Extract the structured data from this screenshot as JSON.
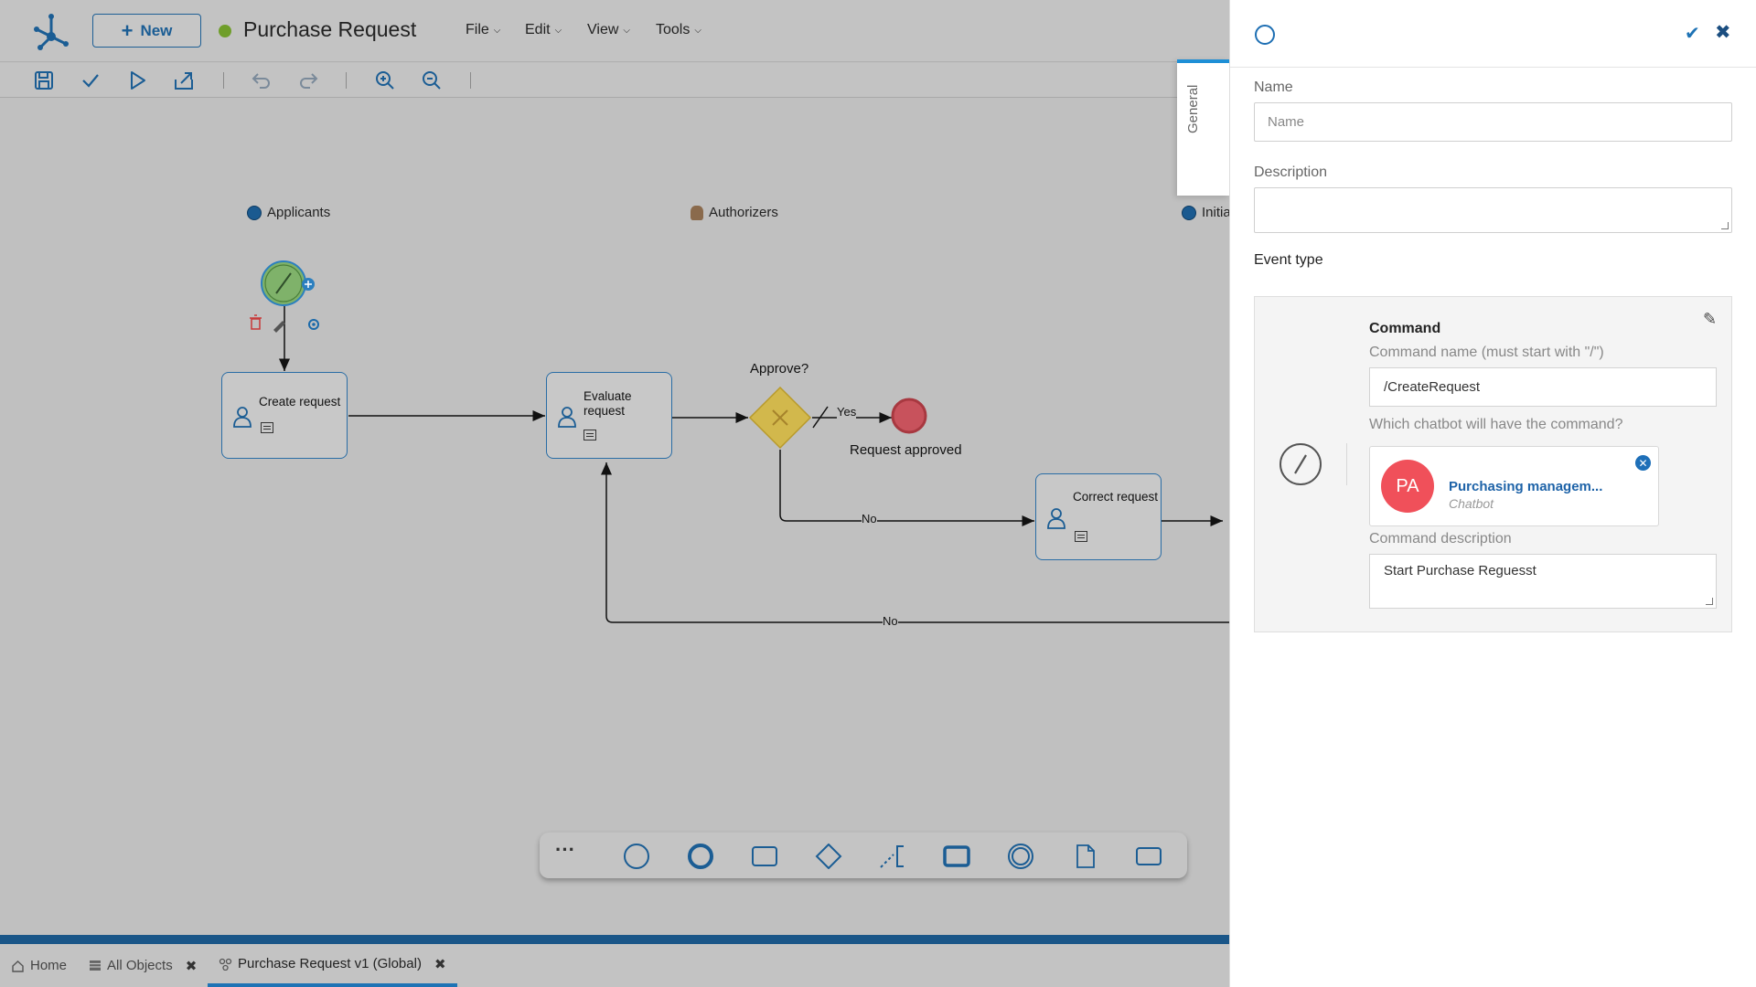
{
  "header": {
    "new_label": "New",
    "title": "Purchase Request",
    "status_color": "#6f9e2a",
    "menus": [
      {
        "label": "File"
      },
      {
        "label": "Edit"
      },
      {
        "label": "View"
      },
      {
        "label": "Tools"
      }
    ]
  },
  "toolbar": {
    "icons": [
      "save-icon",
      "check-icon",
      "run-icon",
      "export-icon",
      "undo-icon",
      "redo-icon",
      "zoom-in-icon",
      "zoom-out-icon"
    ]
  },
  "lanes": [
    {
      "label": "Applicants"
    },
    {
      "label": "Authorizers"
    },
    {
      "label": "Initia"
    }
  ],
  "diagram": {
    "tasks": [
      {
        "label": "Create request"
      },
      {
        "label": "Evaluate request"
      },
      {
        "label": "Correct request"
      }
    ],
    "gateway_label": "Approve?",
    "end_event_label": "Request approved",
    "flow_labels": {
      "yes": "Yes",
      "no_1": "No",
      "no_2": "No"
    }
  },
  "palette": {
    "items": [
      "more-icon",
      "start-event-icon",
      "end-event-icon",
      "task-icon",
      "gateway-icon",
      "annotation-icon",
      "subprocess-icon",
      "intermediate-event-icon",
      "data-object-icon",
      "pool-icon"
    ]
  },
  "tabs": [
    {
      "label": "Home",
      "closable": false
    },
    {
      "label": "All Objects",
      "closable": true
    },
    {
      "label": "Purchase Request v1 (Global)",
      "closable": true,
      "active": true
    }
  ],
  "panel": {
    "side_tab": "General",
    "name_label": "Name",
    "name_placeholder": "Name",
    "description_label": "Description",
    "event_type_label": "Event type",
    "command": {
      "title": "Command",
      "name_label": "Command name (must start with \"/\")",
      "name_value": "/CreateRequest",
      "chatbot_label": "Which chatbot will have the command?",
      "chatbot": {
        "initials": "PA",
        "name": "Purchasing managem...",
        "type": "Chatbot",
        "color": "#f0505a"
      },
      "description_label": "Command description",
      "description_value": "Start Purchase Reguesst"
    }
  },
  "colors": {
    "accent": "#1e73b5",
    "task_border": "#2a6da5",
    "end_event": "#c8525c",
    "gateway": "#d2b84c"
  }
}
